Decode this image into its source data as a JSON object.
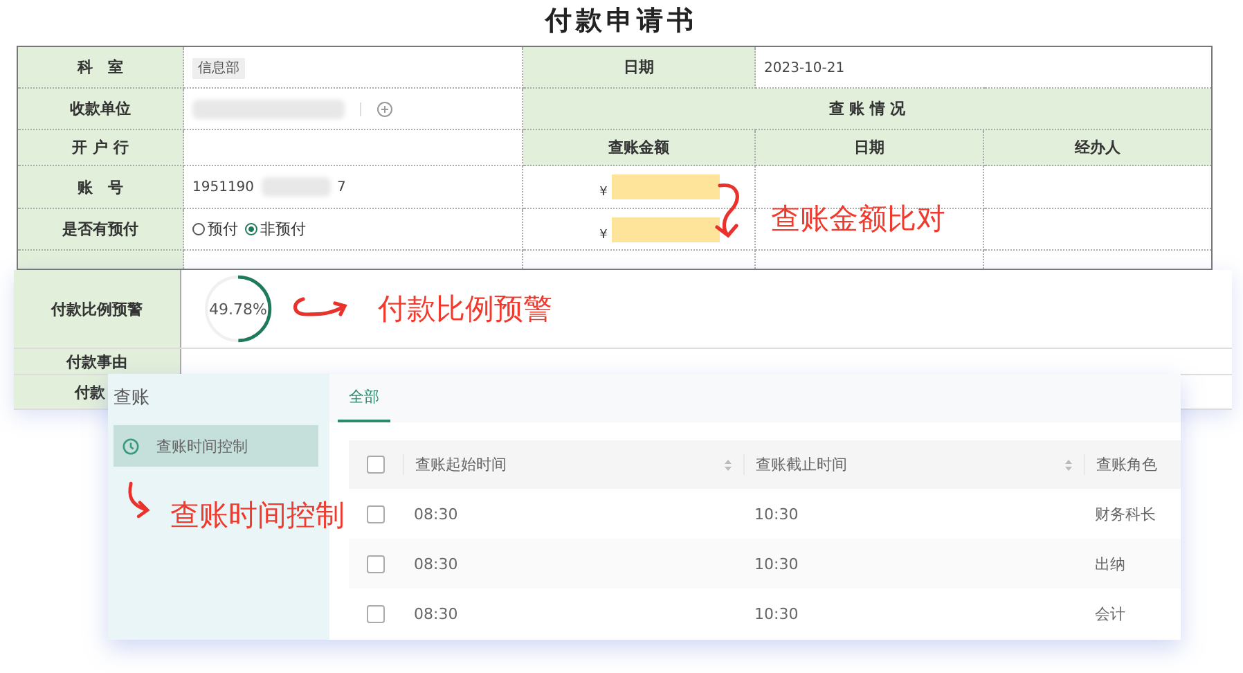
{
  "title": "付款申请书",
  "form": {
    "department_label": "科　室",
    "department": "信息部",
    "date_label": "日期",
    "date": "2023-10-21",
    "payee_label": "收款单位",
    "audit_heading": "查 账 情 况",
    "bank_label": "开 户 行",
    "audit_columns": [
      "查账金额",
      "日期",
      "经办人"
    ],
    "account_label": "账　号",
    "account_start": "1951190",
    "account_end": "7",
    "prepay_label": "是否有预付",
    "prepay_options": [
      {
        "label": "预付",
        "selected": false
      },
      {
        "label": "非预付",
        "selected": true
      }
    ],
    "currency": [
      "¥",
      "¥"
    ]
  },
  "amount_note": "查账金额比对",
  "ratio": {
    "label": "付款比例预警",
    "value": "49.78%",
    "level": 0.4978,
    "reason_label": "付款事由",
    "next_label": "付款"
  },
  "ratio_note": "付款比例预警",
  "audit": {
    "title": "查账",
    "menu": [
      {
        "label": "查账时间控制",
        "selected": true
      }
    ],
    "tabs": [
      {
        "label": "全部",
        "selected": true
      }
    ],
    "all_checked": false,
    "columns": [
      "查账起始时间",
      "查账截止时间",
      "查账角色"
    ],
    "rows": [
      {
        "checked": false,
        "start": "08:30",
        "end": "10:30",
        "role": "财务科长"
      },
      {
        "checked": false,
        "start": "08:30",
        "end": "10:30",
        "role": "出纳"
      },
      {
        "checked": false,
        "start": "08:30",
        "end": "10:30",
        "role": "会计"
      }
    ]
  },
  "audit_note": "查账时间控制"
}
